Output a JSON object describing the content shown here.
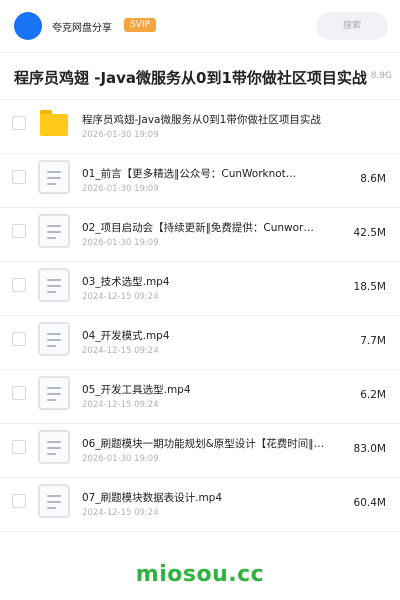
{
  "header": {
    "share_name": "夸克网盘分享",
    "badge": "SVIP",
    "search_placeholder": "搜索"
  },
  "title_row": {
    "title": "程序员鸡翅 -Java微服务从0到1带你做社区项目实战",
    "total_size": "8.9G"
  },
  "files": [
    {
      "type": "folder",
      "name": "程序员鸡翅-Java微服务从0到1带你做社区项目实战",
      "date": "2026-01-30 19:09",
      "size": ""
    },
    {
      "type": "file",
      "name": "01_前言【更多精选‖公众号：CunWorknot…",
      "date": "2026-01-30 19:09",
      "size": "8.6M"
    },
    {
      "type": "file",
      "name": "02_项目启动会【持续更新‖免费提供：Cunwor…",
      "date": "2026-01-30 19:09",
      "size": "42.5M"
    },
    {
      "type": "file",
      "name": "03_技术选型.mp4",
      "date": "2024-12-15 09:24",
      "size": "18.5M"
    },
    {
      "type": "file",
      "name": "04_开发模式.mp4",
      "date": "2024-12-15 09:24",
      "size": "7.7M"
    },
    {
      "type": "file",
      "name": "05_开发工具选型.mp4",
      "date": "2024-12-15 09:24",
      "size": "6.2M"
    },
    {
      "type": "file",
      "name": "06_刷题模块一期功能规划&原型设计【花费时间‖免…",
      "date": "2026-01-30 19:09",
      "size": "83.0M"
    },
    {
      "type": "file",
      "name": "07_刷题模块数据表设计.mp4",
      "date": "2024-12-15 09:24",
      "size": "60.4M"
    }
  ],
  "watermark": "miosou.cc",
  "colors": {
    "avatar": "#1a73f5",
    "svip_badge": "#f5a442",
    "folder": "#ffc81a",
    "watermark": "#2fb33f"
  }
}
